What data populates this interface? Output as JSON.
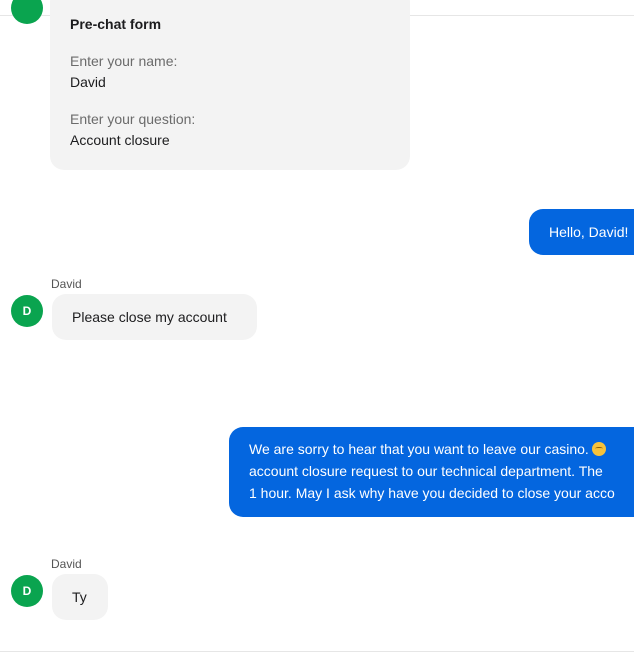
{
  "form": {
    "title": "Pre-chat form",
    "name_label": "Enter your name:",
    "name_value": "David",
    "question_label": "Enter your question:",
    "question_value": "Account closure"
  },
  "messages": [
    {
      "from": "agent",
      "text": "Hello, David!"
    },
    {
      "from": "visitor",
      "sender": "David",
      "avatar": "D",
      "text": "Please close my account"
    },
    {
      "from": "agent",
      "lines": [
        "We are sorry to hear that you want to leave our casino.",
        "account closure request to our technical department. The",
        "1 hour. May I ask why have you decided to close your acco"
      ],
      "emoji": "disappointed-face-icon"
    },
    {
      "from": "visitor",
      "sender": "David",
      "avatar": "D",
      "text": "Ty"
    }
  ],
  "colors": {
    "agent_bubble": "#0466df",
    "visitor_bubble": "#f3f3f3",
    "avatar": "#0aa44f"
  }
}
